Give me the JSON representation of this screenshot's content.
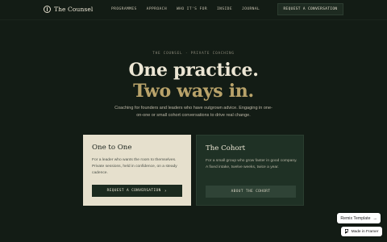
{
  "nav": {
    "logo_text": "The Counsel",
    "links": [
      "PROGRAMMES",
      "APPROACH",
      "WHO IT'S FOR",
      "INSIDE",
      "JOURNAL"
    ],
    "cta": "REQUEST A CONVERSATION"
  },
  "hero": {
    "eyebrow": "THE COUNSEL · PRIVATE COACHING",
    "headline_1": "One practice.",
    "headline_2": "Two ways in.",
    "lede": "Coaching for founders and leaders who have outgrown advice. Engaging in one-on-one or small cohort conversations to drive real change."
  },
  "cards": [
    {
      "title": "One to One",
      "body": "For a leader who wants the room to themselves. Private sessions, held in confidence, on a steady cadence.",
      "button": "REQUEST A CONVERSATION",
      "button_icon": "chevron-right-icon"
    },
    {
      "title": "The Cohort",
      "body": "For a small group who grow faster in good company. A fixed intake, twelve weeks, twice a year.",
      "button": "ABOUT THE COHORT"
    }
  ],
  "badges": {
    "remix": "Remix Template",
    "remix_arrow": "→",
    "framer": "Made in Framer"
  },
  "colors": {
    "background": "#131c15",
    "accent_gold": "#b9a36a",
    "card_light": "#e6e0cd",
    "card_dark": "#1f3125"
  }
}
